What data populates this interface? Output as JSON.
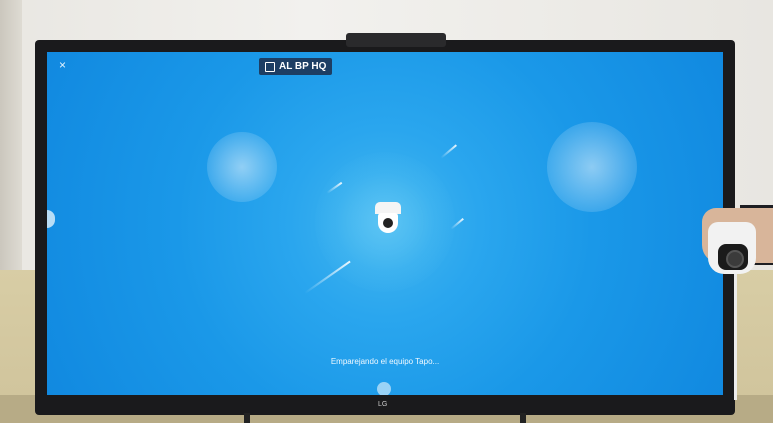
{
  "app": {
    "badge_text": "AL BP HQ",
    "close_glyph": "×",
    "status_text": "Emparejando el equipo Tapo...",
    "tv_brand": "LG"
  },
  "icons": {
    "close": "close-icon",
    "badge": "home-icon",
    "device": "camera-icon"
  },
  "colors": {
    "screen_blue": "#1a98e8",
    "badge_bg": "#1d3e64"
  }
}
